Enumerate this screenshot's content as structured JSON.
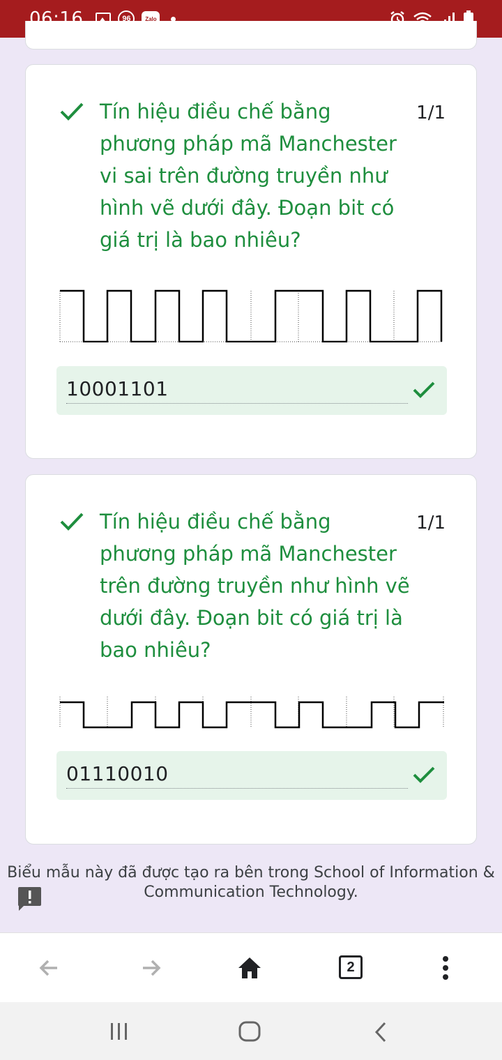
{
  "status_bar": {
    "time": "06:16",
    "left_icons": [
      "image-icon",
      "notification-96-icon",
      "zalo-icon",
      "dot-icon"
    ],
    "right_icons": [
      "alarm-icon",
      "wifi-icon",
      "signal-icon",
      "battery-icon"
    ],
    "badge_96": "96",
    "zalo_label": "Zalo",
    "bar_color": "#a51c1e"
  },
  "questions": [
    {
      "text": "Tín hiệu điều chế bằng phương pháp mã Manchester vi sai trên đường truyền như hình vẽ dưới đây. Đoạn bit có giá trị là bao nhiêu?",
      "score": "1/1",
      "answer": "10001101",
      "correct": true
    },
    {
      "text": "Tín hiệu điều chế bằng phương pháp mã Manchester trên đường truyền như hình vẽ dưới đây. Đoạn bit có giá trị là bao nhiêu?",
      "score": "1/1",
      "answer": "01110010",
      "correct": true
    }
  ],
  "footer": {
    "text": "Biểu mẫu này đã được tạo ra bên trong School of Information & Communication Technology."
  },
  "browser_toolbar": {
    "tab_count": "2",
    "icons": [
      "back-arrow-icon",
      "forward-arrow-icon",
      "home-icon",
      "tab-switcher-icon",
      "more-vert-icon"
    ]
  },
  "system_nav": {
    "icons": [
      "recent-apps-icon",
      "home-circle-icon",
      "back-icon"
    ]
  },
  "colors": {
    "accent_green": "#1e8e3e",
    "answer_bg": "#e6f4ea",
    "page_bg": "#ede7f6"
  }
}
